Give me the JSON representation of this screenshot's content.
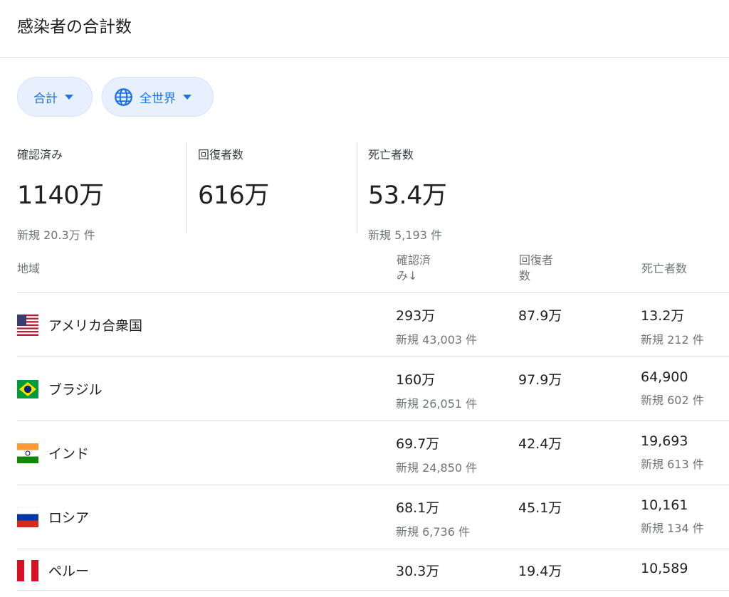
{
  "header": {
    "title": "感染者の合計数"
  },
  "filters": {
    "total": {
      "label": "合計"
    },
    "region": {
      "label": "全世界"
    }
  },
  "stats": {
    "confirmed": {
      "label": "確認済み",
      "value": "1140万",
      "new": "新規 20.3万 件"
    },
    "recovered": {
      "label": "回復者数",
      "value": "616万"
    },
    "deaths": {
      "label": "死亡者数",
      "value": "53.4万",
      "new": "新規 5,193 件"
    }
  },
  "table": {
    "headers": {
      "region": "地域",
      "confirmed_line1": "確認済",
      "confirmed_line2": "み↓",
      "recovered_line1": "回復者",
      "recovered_line2": "数",
      "deaths": "死亡者数"
    },
    "rows": [
      {
        "country": "アメリカ合衆国",
        "flag": "us",
        "confirmed": "293万",
        "confirmed_new": "新規 43,003 件",
        "recovered": "87.9万",
        "deaths": "13.2万",
        "deaths_new": "新規 212 件"
      },
      {
        "country": "ブラジル",
        "flag": "br",
        "confirmed": "160万",
        "confirmed_new": "新規 26,051 件",
        "recovered": "97.9万",
        "deaths": "64,900",
        "deaths_new": "新規 602 件"
      },
      {
        "country": "インド",
        "flag": "in",
        "confirmed": "69.7万",
        "confirmed_new": "新規 24,850 件",
        "recovered": "42.4万",
        "deaths": "19,693",
        "deaths_new": "新規 613 件"
      },
      {
        "country": "ロシア",
        "flag": "ru",
        "confirmed": "68.1万",
        "confirmed_new": "新規 6,736 件",
        "recovered": "45.1万",
        "deaths": "10,161",
        "deaths_new": "新規 134 件"
      },
      {
        "country": "ペルー",
        "flag": "pe",
        "confirmed": "30.3万",
        "recovered": "19.4万",
        "deaths": "10,589"
      }
    ]
  },
  "colors": {
    "accent": "#1a73e8",
    "chip_bg": "#e8f0fe",
    "muted": "#70757a",
    "divider": "#dadce0"
  }
}
